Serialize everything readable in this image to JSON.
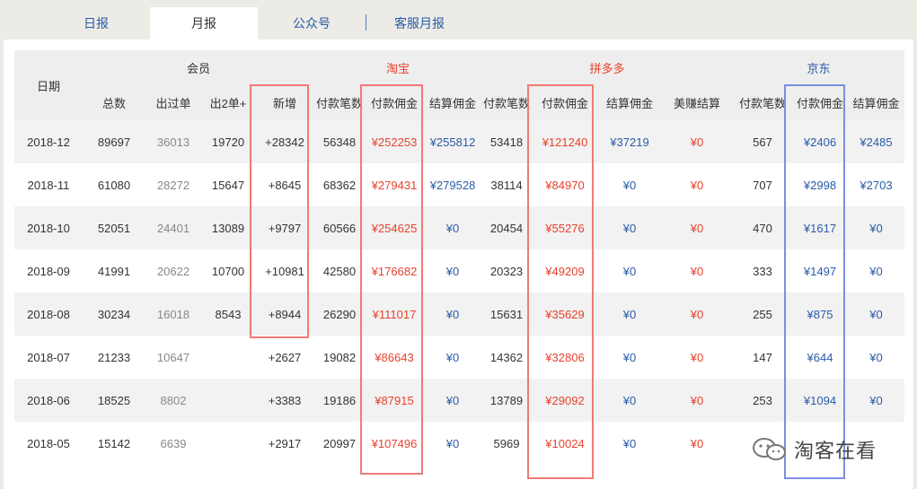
{
  "tabs": [
    {
      "label": "日报"
    },
    {
      "label": "月报"
    },
    {
      "label": "公众号"
    },
    {
      "label": "客服月报"
    }
  ],
  "headers": {
    "date": "日期",
    "groups": {
      "member": "会员",
      "taobao": "淘宝",
      "pdd": "拼多多",
      "jd": "京东"
    },
    "columns": [
      "总数",
      "出过单",
      "出2单+",
      "新增",
      "付款笔数",
      "付款佣金",
      "结算佣金",
      "付款笔数",
      "付款佣金",
      "结算佣金",
      "美赚结算",
      "付款笔数",
      "付款佣金",
      "结算佣金"
    ]
  },
  "rows": [
    {
      "date": "2018-12",
      "total": "89697",
      "ordered": "36013",
      "ordered2": "19720",
      "new": "+28342",
      "tb_cnt": "56348",
      "tb_pay": "¥252253",
      "tb_settle": "¥255812",
      "pdd_cnt": "53418",
      "pdd_pay": "¥121240",
      "pdd_settle": "¥37219",
      "mz": "¥0",
      "jd_cnt": "567",
      "jd_pay": "¥2406",
      "jd_settle": "¥2485"
    },
    {
      "date": "2018-11",
      "total": "61080",
      "ordered": "28272",
      "ordered2": "15647",
      "new": "+8645",
      "tb_cnt": "68362",
      "tb_pay": "¥279431",
      "tb_settle": "¥279528",
      "pdd_cnt": "38114",
      "pdd_pay": "¥84970",
      "pdd_settle": "¥0",
      "mz": "¥0",
      "jd_cnt": "707",
      "jd_pay": "¥2998",
      "jd_settle": "¥2703"
    },
    {
      "date": "2018-10",
      "total": "52051",
      "ordered": "24401",
      "ordered2": "13089",
      "new": "+9797",
      "tb_cnt": "60566",
      "tb_pay": "¥254625",
      "tb_settle": "¥0",
      "pdd_cnt": "20454",
      "pdd_pay": "¥55276",
      "pdd_settle": "¥0",
      "mz": "¥0",
      "jd_cnt": "470",
      "jd_pay": "¥1617",
      "jd_settle": "¥0"
    },
    {
      "date": "2018-09",
      "total": "41991",
      "ordered": "20622",
      "ordered2": "10700",
      "new": "+10981",
      "tb_cnt": "42580",
      "tb_pay": "¥176682",
      "tb_settle": "¥0",
      "pdd_cnt": "20323",
      "pdd_pay": "¥49209",
      "pdd_settle": "¥0",
      "mz": "¥0",
      "jd_cnt": "333",
      "jd_pay": "¥1497",
      "jd_settle": "¥0"
    },
    {
      "date": "2018-08",
      "total": "30234",
      "ordered": "16018",
      "ordered2": "8543",
      "new": "+8944",
      "tb_cnt": "26290",
      "tb_pay": "¥111017",
      "tb_settle": "¥0",
      "pdd_cnt": "15631",
      "pdd_pay": "¥35629",
      "pdd_settle": "¥0",
      "mz": "¥0",
      "jd_cnt": "255",
      "jd_pay": "¥875",
      "jd_settle": "¥0"
    },
    {
      "date": "2018-07",
      "total": "21233",
      "ordered": "10647",
      "ordered2": "",
      "new": "+2627",
      "tb_cnt": "19082",
      "tb_pay": "¥86643",
      "tb_settle": "¥0",
      "pdd_cnt": "14362",
      "pdd_pay": "¥32806",
      "pdd_settle": "¥0",
      "mz": "¥0",
      "jd_cnt": "147",
      "jd_pay": "¥644",
      "jd_settle": "¥0"
    },
    {
      "date": "2018-06",
      "total": "18525",
      "ordered": "8802",
      "ordered2": "",
      "new": "+3383",
      "tb_cnt": "19186",
      "tb_pay": "¥87915",
      "tb_settle": "¥0",
      "pdd_cnt": "13789",
      "pdd_pay": "¥29092",
      "pdd_settle": "¥0",
      "mz": "¥0",
      "jd_cnt": "253",
      "jd_pay": "¥1094",
      "jd_settle": "¥0"
    },
    {
      "date": "2018-05",
      "total": "15142",
      "ordered": "6639",
      "ordered2": "",
      "new": "+2917",
      "tb_cnt": "20997",
      "tb_pay": "¥107496",
      "tb_settle": "¥0",
      "pdd_cnt": "5969",
      "pdd_pay": "¥10024",
      "pdd_settle": "¥0",
      "mz": "¥0",
      "jd_cnt": "",
      "jd_pay": "",
      "jd_settle": ""
    }
  ],
  "watermark": {
    "text": "淘客在看",
    "icon": "wechat-icon"
  },
  "colors": {
    "red": "#e8412c",
    "blue": "#2a5ba8",
    "highlight_red": "#ef7b73",
    "highlight_blue": "#7b8fe0"
  }
}
